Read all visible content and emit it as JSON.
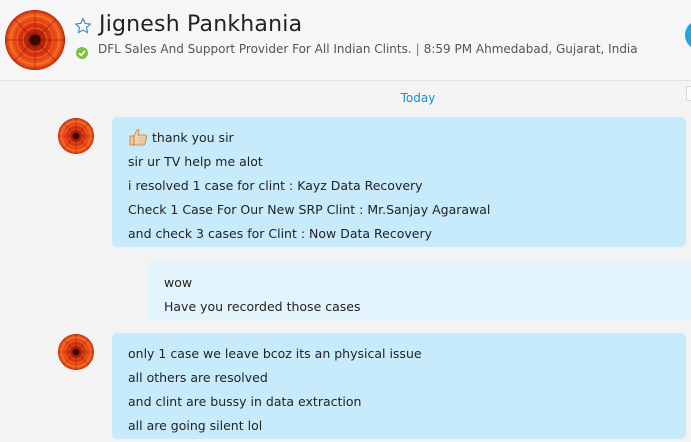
{
  "header": {
    "name": "Jignesh Pankhania",
    "mood": "DFL Sales And Support Provider For All Indian Clints.",
    "separator": "|",
    "local_time": "8:59 PM Ahmedabad, Gujarat, India",
    "status": "online",
    "favorite_icon": "star-outline-icon",
    "status_icon": "online-check-icon",
    "accent_color": "#1d8fcf"
  },
  "conversation": {
    "day_label": "Today",
    "messages": [
      {
        "direction": "incoming",
        "emoticon": "thumbs-up-emoticon",
        "lines": [
          "thank you sir",
          "sir ur TV help me alot",
          "i resolved 1 case for clint : Kayz Data Recovery",
          "Check 1 Case For Our New SRP Clint : Mr.Sanjay Agarawal",
          "and check 3 cases for Clint : Now Data Recovery"
        ]
      },
      {
        "direction": "outgoing",
        "lines": [
          "wow",
          "Have you recorded those cases"
        ]
      },
      {
        "direction": "incoming",
        "lines": [
          "only 1 case we leave bcoz its an physical issue",
          "all others are resolved",
          "and clint are bussy in data extraction",
          "all are going silent lol"
        ]
      }
    ]
  },
  "colors": {
    "incoming_bubble": "#c7ebfb",
    "outgoing_bubble": "#e3f4fc",
    "background": "#f3f3f3"
  }
}
